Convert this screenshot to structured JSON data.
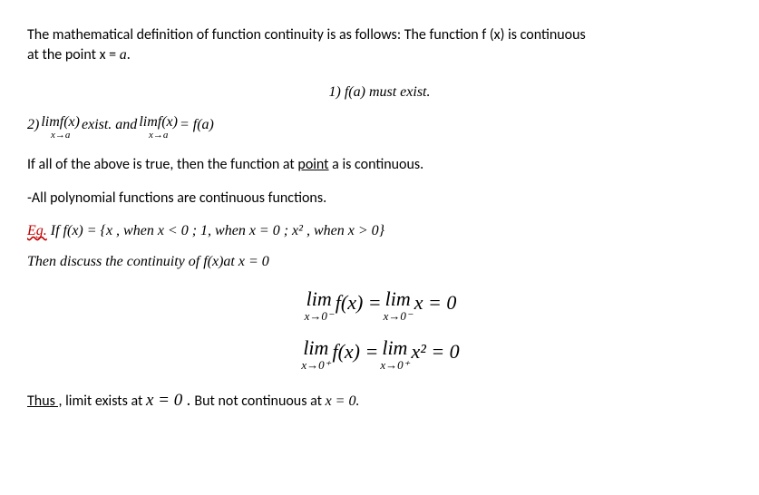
{
  "intro": {
    "line1": "The mathematical definition of function continuity is as follows: The function f (x) is continuous",
    "line2_a": "at the point x = ",
    "line2_b": "a",
    "line2_c": "."
  },
  "cond1": {
    "prefix": "1) ",
    "fa": "f(a)",
    "rest": " must exist."
  },
  "cond2": {
    "prefix": "2) ",
    "lim": "limf",
    "arg": "(x)",
    "sub": "x→a",
    "mid1": " exist. and ",
    "eq": " = f(a)"
  },
  "ifall": {
    "a": "If all of the above is true, then the function at ",
    "point": "point",
    "b": " a is continuous."
  },
  "poly": "-All polynomial functions are continuous functions.",
  "eg": {
    "label": "Eg.",
    "body": " If f(x) = {x , when x < 0   ;    1, when x = 0    ;    x² , when x > 0}"
  },
  "then": "Then discuss the continuity of f(x)at x = 0",
  "eq1": {
    "lim_top": "lim",
    "sub_left": "x→0⁻",
    "mid_fx": " f(x)  =  ",
    "sub_right": "x→0⁻",
    "rhs": " x  = 0"
  },
  "eq2": {
    "lim_top": "lim",
    "sub_left": "x→0⁺",
    "mid_fx": " f(x)  =  ",
    "sub_right": "x→0⁺",
    "rhs": " x²  = 0"
  },
  "thus": {
    "label": "Thus ,",
    "a": " limit exists at ",
    "x": "x  = 0 .",
    "b": " But not continuous at ",
    "x2": "x  = 0."
  }
}
